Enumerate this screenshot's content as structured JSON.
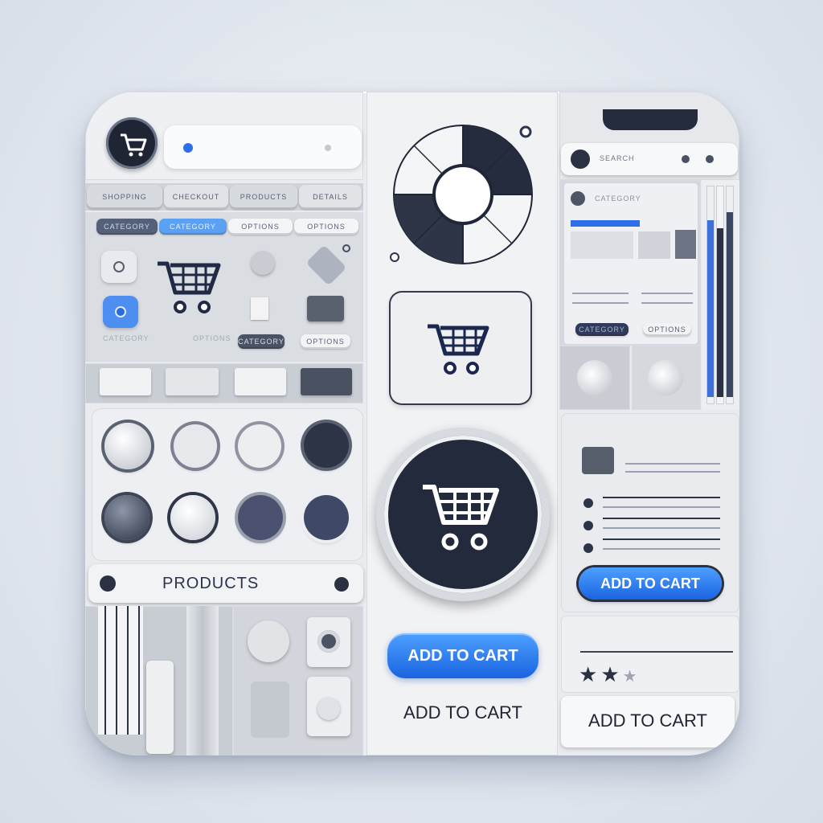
{
  "tabs": [
    "SHOPPING",
    "CHECKOUT",
    "PRODUCTS",
    "DETAILS"
  ],
  "subtabs": [
    "CATEGORY",
    "CATEGORY",
    "OPTIONS",
    "OPTIONS"
  ],
  "small_buttons": [
    "CATEGORY",
    "OPTIONS"
  ],
  "field_labels": [
    "CATEGORY",
    "OPTIONS"
  ],
  "products_label": "PRODUCTS",
  "add_to_cart_blue_center": "ADD TO CART",
  "add_to_cart_plain_center": "ADD TO CART",
  "add_to_cart_blue_right": "ADD TO CART",
  "add_to_cart_plain_right": "ADD TO CART",
  "right_phone_search": "SEARCH",
  "right_mini_labels": [
    "CATEGORY",
    "OPTIONS"
  ],
  "rating": {
    "filled": 2,
    "total": 3
  },
  "colors": {
    "accent": "#1f6ff0",
    "dark": "#252c3d"
  }
}
